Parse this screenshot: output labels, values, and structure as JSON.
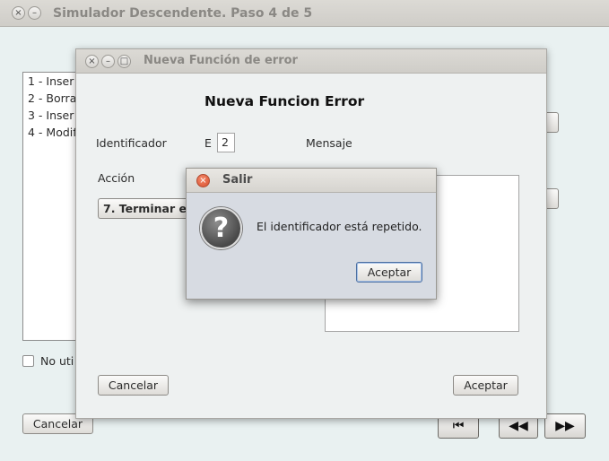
{
  "main_window": {
    "title": "Simulador Descendente. Paso 4 de 5",
    "close_glyph": "×",
    "minimize_glyph": "–",
    "header_partial": "",
    "list_items": [
      "1 - Inser",
      "2 - Borra",
      "3 - Inser",
      "4 - Modif"
    ],
    "checkbox_label": "No uti",
    "cancel_label": "Cancelar",
    "nav_first_glyph": "⏮",
    "nav_prev_glyph": "◀◀",
    "nav_next_glyph": "▶▶"
  },
  "error_dialog": {
    "title": "Nueva Función de error",
    "heading": "Nueva Funcion Error",
    "close_glyph": "×",
    "minimize_glyph": "–",
    "maximize_glyph": "□",
    "identifier_label": "Identificador",
    "identifier_prefix": "E",
    "identifier_value": "2",
    "message_label": "Mensaje",
    "action_label": "Acción",
    "action_selected": "7. Terminar el",
    "cancel_label": "Cancelar",
    "accept_label": "Aceptar"
  },
  "alert": {
    "title": "Salir",
    "close_glyph": "×",
    "icon_glyph": "?",
    "message": "El identificador está repetido.",
    "accept_label": "Aceptar"
  },
  "colors": {
    "close_button": "#e0603f",
    "window_bg": "#e9f1f1",
    "dialog_bg": "#eef1f1",
    "alert_bg": "#d7dbe2"
  }
}
